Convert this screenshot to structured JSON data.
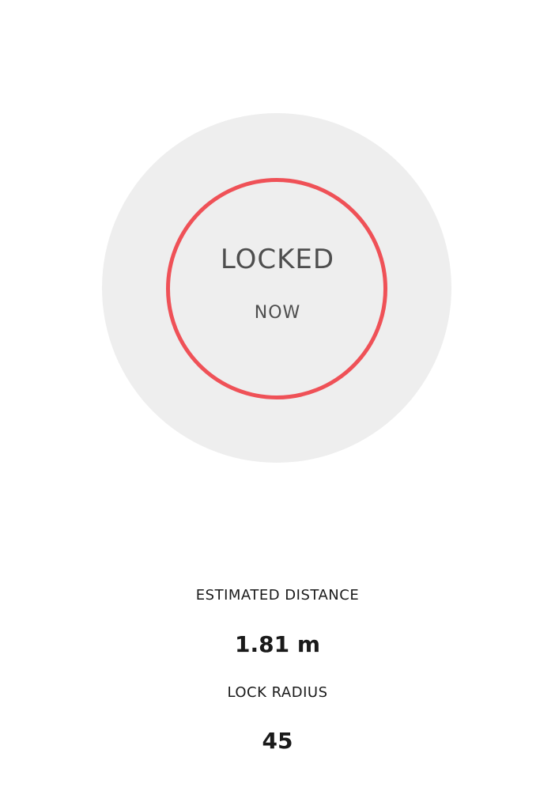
{
  "status": {
    "main": "LOCKED",
    "sub": "NOW",
    "ring_color": "#ef5157"
  },
  "info": {
    "distance_label": "ESTIMATED DISTANCE",
    "distance_value": "1.81 m",
    "radius_label": "LOCK RADIUS",
    "radius_value": "45"
  }
}
